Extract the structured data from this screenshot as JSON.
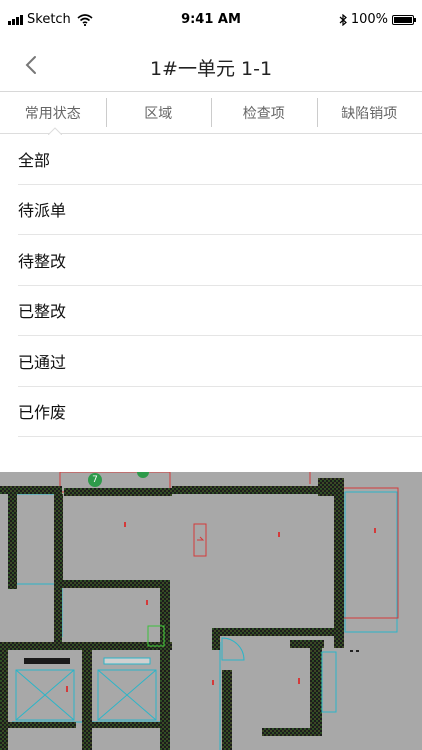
{
  "status_bar": {
    "carrier": "Sketch",
    "time": "9:41 AM",
    "battery": "100%"
  },
  "nav": {
    "title": "1#一单元 1-1"
  },
  "tabs": [
    {
      "label": "常用状态"
    },
    {
      "label": "区域"
    },
    {
      "label": "检查项"
    },
    {
      "label": "缺陷销项"
    }
  ],
  "status_options": [
    {
      "label": "全部"
    },
    {
      "label": "待派单"
    },
    {
      "label": "待整改"
    },
    {
      "label": "已整改"
    },
    {
      "label": "已通过"
    },
    {
      "label": "已作废"
    }
  ],
  "plan": {
    "marker_label": "7"
  },
  "colors": {
    "plan_bg": "#a8a8a8",
    "wall": "#1a1a1a",
    "wall_hatch": "#3c8a2a",
    "cad_line": "#d43a3a",
    "marker": "#2e9a4a"
  }
}
